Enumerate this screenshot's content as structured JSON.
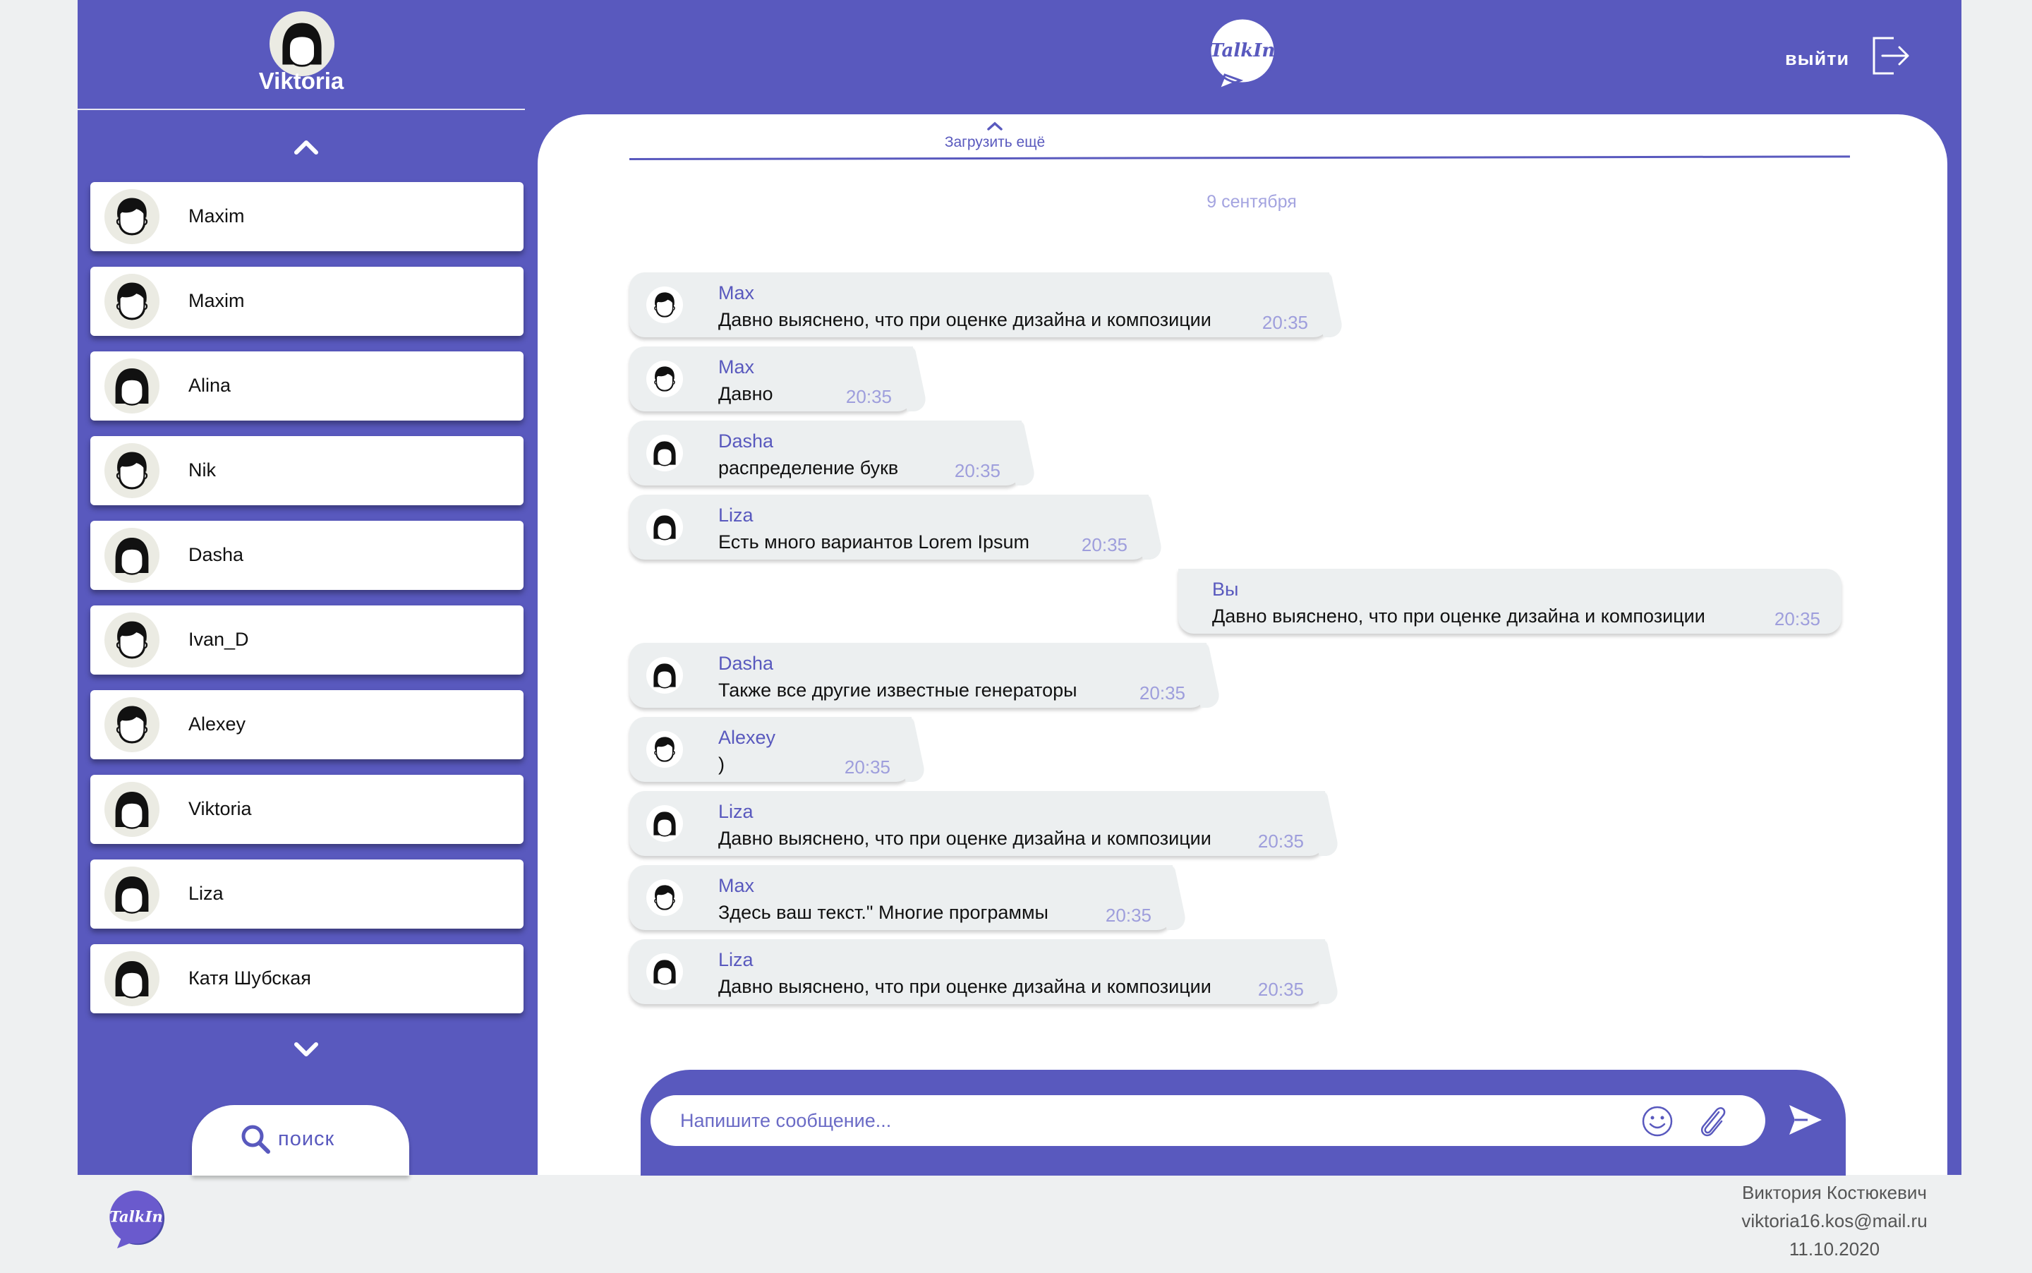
{
  "colors": {
    "brand": "#5959be",
    "bubble": "#eceff0",
    "time": "#9e9edc",
    "background": "#eef0f1"
  },
  "profile": {
    "name": "Viktoria"
  },
  "logo": {
    "text": "TalkIn"
  },
  "header": {
    "logout_label": "выйти"
  },
  "sidebar": {
    "contacts": [
      {
        "name": "Maxim",
        "avatar": "boy"
      },
      {
        "name": "Maxim",
        "avatar": "boy"
      },
      {
        "name": "Alina",
        "avatar": "girl"
      },
      {
        "name": "Nik",
        "avatar": "boy"
      },
      {
        "name": "Dasha",
        "avatar": "girl"
      },
      {
        "name": "Ivan_D",
        "avatar": "boy"
      },
      {
        "name": "Alexey",
        "avatar": "boy"
      },
      {
        "name": "Viktoria",
        "avatar": "girl"
      },
      {
        "name": "Liza",
        "avatar": "girl"
      },
      {
        "name": "Катя Шубская",
        "avatar": "girl"
      }
    ],
    "search_label": "поиск"
  },
  "chat": {
    "load_more": "Загрузить ещё",
    "date": "9 сентября",
    "messages": [
      {
        "author": "Max",
        "text": "Давно выяснено, что при оценке дизайна и композиции",
        "time": "20:35",
        "avatar": "boy"
      },
      {
        "author": "Max",
        "text": "Давно",
        "time": "20:35",
        "avatar": "boy"
      },
      {
        "author": "Dasha",
        "text": "распределение букв",
        "time": "20:35",
        "avatar": "girl"
      },
      {
        "author": "Liza",
        "text": "Есть много вариантов Lorem Ipsum",
        "time": "20:35",
        "avatar": "girl"
      },
      {
        "author": "Вы",
        "text": "Давно выяснено, что при оценке дизайна и композиции",
        "time": "20:35",
        "mine": true
      },
      {
        "author": "Dasha",
        "text": "Также все другие известные генераторы",
        "time": "20:35",
        "avatar": "girl"
      },
      {
        "author": "Alexey",
        "text": ")",
        "time": "20:35",
        "avatar": "boy"
      },
      {
        "author": "Liza",
        "text": "Давно выяснено, что при оценке дизайна и композиции",
        "time": "20:35",
        "avatar": "girl"
      },
      {
        "author": "Max",
        "text": "Здесь ваш текст.\" Многие программы",
        "time": "20:35",
        "avatar": "boy"
      },
      {
        "author": "Liza",
        "text": "Давно выяснено, что при оценке дизайна и композиции",
        "time": "20:35",
        "avatar": "girl"
      }
    ]
  },
  "composer": {
    "placeholder": "Напишите сообщение..."
  },
  "footer": {
    "author": "Виктория Костюкевич",
    "email": "viktoria16.kos@mail.ru",
    "date": "11.10.2020"
  }
}
